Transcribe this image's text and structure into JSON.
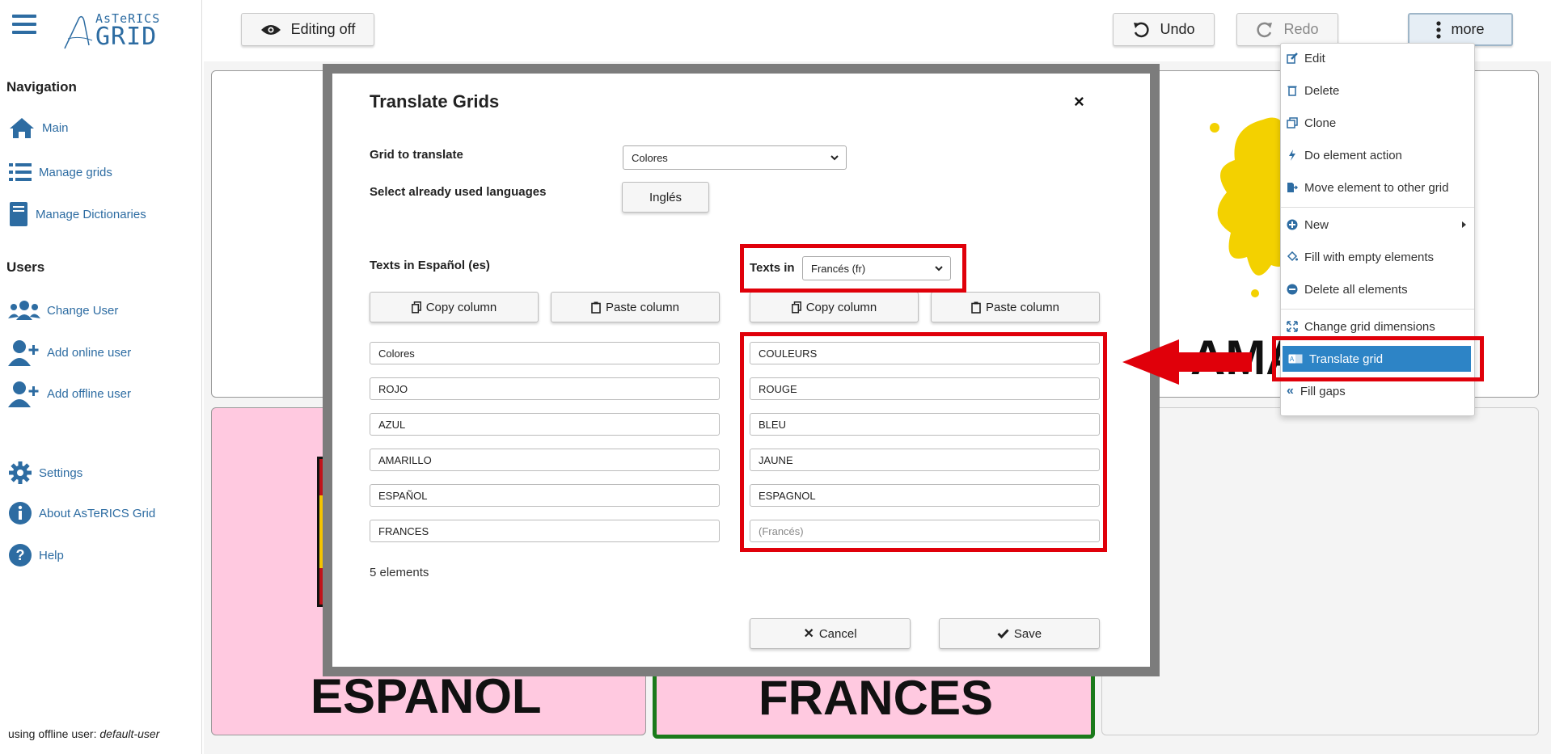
{
  "app": {
    "logo_small": "AsTeRICS",
    "logo_big": "GRID"
  },
  "sidebar": {
    "navigation_heading": "Navigation",
    "nav_items": [
      {
        "label": "Main",
        "icon": "home-icon"
      },
      {
        "label": "Manage grids",
        "icon": "list-icon"
      },
      {
        "label": "Manage Dictionaries",
        "icon": "book-icon"
      }
    ],
    "users_heading": "Users",
    "user_items": [
      {
        "label": "Change User",
        "icon": "users-icon"
      },
      {
        "label": "Add online user",
        "icon": "user-plus-icon"
      },
      {
        "label": "Add offline user",
        "icon": "user-plus-icon"
      }
    ],
    "other_items": [
      {
        "label": "Settings",
        "icon": "gear-icon"
      },
      {
        "label": "About AsTeRICS Grid",
        "icon": "info-icon"
      },
      {
        "label": "Help",
        "icon": "help-icon"
      }
    ],
    "offline_prefix": "using offline user:",
    "offline_user": "default-user"
  },
  "toolbar": {
    "editing_label": "Editing off",
    "undo_label": "Undo",
    "redo_label": "Redo",
    "more_label": "more"
  },
  "grid": {
    "cells": [
      {
        "label": "AMA"
      },
      {
        "label": "ESPANOL"
      },
      {
        "label": "FRANCES"
      }
    ]
  },
  "modal": {
    "title": "Translate Grids",
    "close": "×",
    "grid_to_translate_label": "Grid to translate",
    "grid_to_translate_value": "Colores",
    "used_languages_label": "Select already used languages",
    "used_language_button": "Inglés",
    "texts_in_source_label": "Texts in Español (es)",
    "texts_in_target_label": "Texts in",
    "target_language_value": "Francés (fr)",
    "copy_column": "Copy column",
    "paste_column": "Paste column",
    "source_texts": [
      "Colores",
      "ROJO",
      "AZUL",
      "AMARILLO",
      "ESPAÑOL",
      "FRANCES"
    ],
    "target_texts": [
      "COULEURS",
      "ROUGE",
      "BLEU",
      "JAUNE",
      "ESPAGNOL",
      ""
    ],
    "target_placeholder_last": "(Francés)",
    "count_text": "5 elements",
    "cancel_label": "Cancel",
    "save_label": "Save"
  },
  "menu": {
    "items": [
      "Edit",
      "Delete",
      "Clone",
      "Do element action",
      "Move element to other grid",
      "New",
      "Fill with empty elements",
      "Delete all elements",
      "Change grid dimensions",
      "Translate grid",
      "Fill gaps"
    ],
    "active_item": "Translate grid"
  },
  "colors": {
    "accent": "#2d6ca2",
    "highlight": "#e0000a",
    "menu_active": "#2d84c6",
    "cell_pink": "#ffc9e0",
    "cell_border_selected": "#1b7a1b"
  }
}
